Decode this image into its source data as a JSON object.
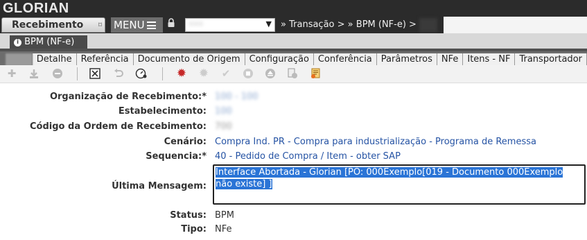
{
  "app": {
    "brand": "GLORIAN"
  },
  "nav": {
    "module_label": "Recebimento",
    "menu_label": "MENU",
    "org_placeholder": "•••",
    "breadcrumb_1": "Transação >",
    "breadcrumb_2": "BPM (NF-e) >"
  },
  "doc_tab": {
    "label": "BPM (NF-e)"
  },
  "subtabs": [
    "Detalhe",
    "Referência",
    "Documento de Origem",
    "Configuração",
    "Conferência",
    "Parâmetros",
    "NFe",
    "Itens - NF",
    "Transportador"
  ],
  "toolbar": {
    "icons": [
      "add-icon",
      "download-icon",
      "remove-icon",
      "close-box-icon",
      "undo-icon",
      "gauge-icon",
      "red-gear-icon",
      "gear-icon",
      "check-icon",
      "stop-icon",
      "eject-icon",
      "document-icon",
      "report-icon"
    ]
  },
  "form": {
    "org_label": "Organização de Recebimento:*",
    "org_value": "100 - 100",
    "estab_label": "Estabelecimento:",
    "estab_value": "100",
    "codigo_label": "Código da Ordem de Recebimento:",
    "codigo_value": "700",
    "cenario_label": "Cenário:",
    "cenario_value": "Compra Ind. PR - Compra para industrialização - Programa de Remessa",
    "sequencia_label": "Sequencia:*",
    "sequencia_value": "40 - Pedido de Compra / Item - obter SAP",
    "ultima_label": "Última Mensagem:",
    "ultima_line1": "Interface Abortada - Glorian [PO: 000Exemplo[019 - Documento 000Exemplo",
    "ultima_line2": "não existe] ]",
    "status_label": "Status:",
    "status_value": "BPM",
    "tipo_label": "Tipo:",
    "tipo_value": "NFe"
  },
  "colors": {
    "link": "#2553a4",
    "selection": "#2a74d6",
    "dark_bar": "#2b2b2b"
  }
}
